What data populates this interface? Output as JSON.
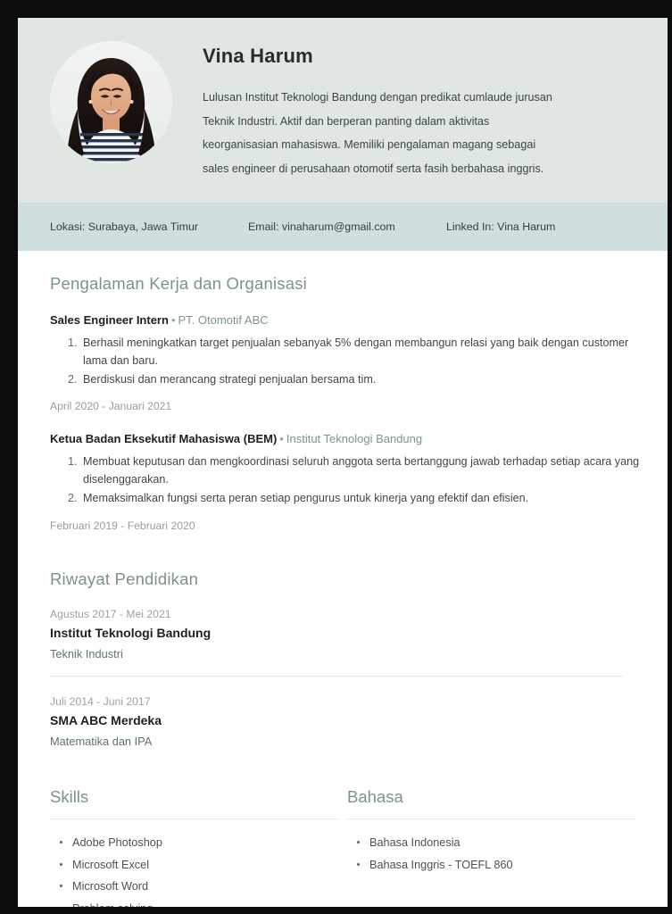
{
  "profile": {
    "name": "Vina Harum",
    "summary": "Lulusan Institut Teknologi Bandung dengan predikat cumlaude jurusan Teknik Industri. Aktif dan berperan panting dalam aktivitas keorganisasian mahasiswa. Memiliki pengalaman magang sebagai sales engineer di perusahaan otomotif serta fasih berbahasa inggris.",
    "avatar_icon": "person-photo-avatar"
  },
  "contact": {
    "location": "Lokasi: Surabaya, Jawa Timur",
    "email": "Email: vinaharum@gmail.com",
    "linkedin": "Linked In: Vina Harum"
  },
  "experience": {
    "title": "Pengalaman Kerja dan Organisasi",
    "entries": [
      {
        "role": "Sales Engineer Intern",
        "separator": "•",
        "organization": "PT. Otomotif ABC",
        "duties": [
          "Berhasil meningkatkan target penjualan sebanyak 5% dengan membangun relasi yang baik dengan customer lama dan baru.",
          "Berdiskusi dan merancang strategi penjualan bersama tim."
        ],
        "date": "April 2020 - Januari 2021"
      },
      {
        "role": "Ketua Badan Eksekutif Mahasiswa (BEM)",
        "separator": "•",
        "organization": "Institut Teknologi Bandung",
        "duties": [
          "Membuat keputusan dan mengkoordinasi seluruh anggota serta bertanggung jawab terhadap setiap acara yang diselenggarakan.",
          "Memaksimalkan fungsi serta peran setiap pengurus untuk kinerja yang efektif dan efisien."
        ],
        "date": "Februari 2019 - Februari 2020"
      }
    ]
  },
  "education": {
    "title": "Riwayat Pendidikan",
    "entries": [
      {
        "date": "Agustus 2017  - Mei 2021",
        "school": "Institut Teknologi Bandung",
        "major": "Teknik Industri"
      },
      {
        "date": "Juli 2014 - Juni 2017",
        "school": "SMA ABC Merdeka",
        "major": "Matematika dan IPA"
      }
    ]
  },
  "skills": {
    "title": "Skills",
    "items": [
      "Adobe Photoshop",
      "Microsoft Excel",
      "Microsoft Word",
      "Problem solving"
    ]
  },
  "languages": {
    "title": "Bahasa",
    "items": [
      "Bahasa Indonesia",
      "Bahasa Inggris - TOEFL 860"
    ]
  },
  "colors": {
    "header_bg": "#e0e7e2",
    "contact_bg": "#cfdfdf",
    "heading": "#7b938f",
    "organization": "#7e9490",
    "date_text": "#9b9b9b",
    "body_text": "#40474a",
    "frame": "#0c0c0c"
  }
}
